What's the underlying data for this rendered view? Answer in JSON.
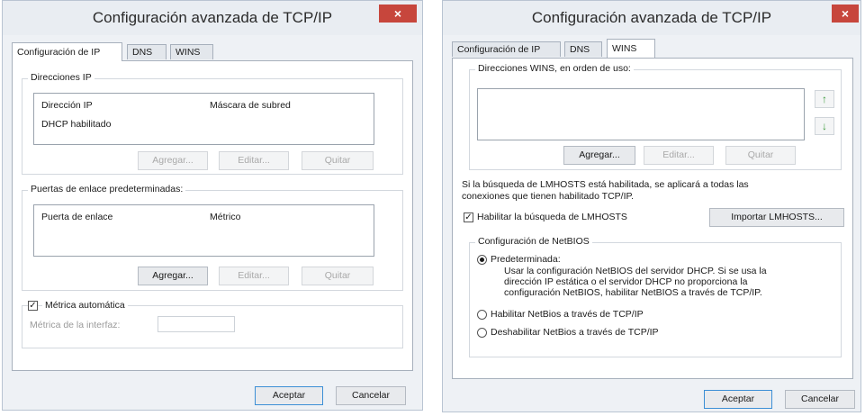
{
  "dialog1": {
    "title": "Configuración avanzada de TCP/IP",
    "close_label": "×",
    "tabs": [
      "Configuración de IP",
      "DNS",
      "WINS"
    ],
    "ip_group": {
      "label": "Direcciones IP",
      "columns": [
        "Dirección IP",
        "Máscara de subred"
      ],
      "rows": [
        "DHCP habilitado"
      ],
      "buttons": [
        "Agregar...",
        "Editar...",
        "Quitar"
      ]
    },
    "gateway_group": {
      "label": "Puertas de enlace predeterminadas:",
      "columns": [
        "Puerta de enlace",
        "Métrico"
      ],
      "buttons": [
        "Agregar...",
        "Editar...",
        "Quitar"
      ]
    },
    "auto_metric": {
      "label": "Métrica automática",
      "checked": true
    },
    "interface_metric_label": "Métrica de la interfaz:",
    "interface_metric_value": "",
    "ok_label": "Aceptar",
    "cancel_label": "Cancelar"
  },
  "dialog2": {
    "title": "Configuración avanzada de TCP/IP",
    "close_label": "×",
    "tabs": [
      "Configuración de IP",
      "DNS",
      "WINS"
    ],
    "wins_group": {
      "label": "Direcciones WINS, en orden de uso:",
      "up_label": "↑",
      "down_label": "↓",
      "buttons": [
        "Agregar...",
        "Editar...",
        "Quitar"
      ]
    },
    "lmhosts_info_line1": "Si la búsqueda de LMHOSTS está habilitada, se aplicará a todas las",
    "lmhosts_info_line2": "conexiones que tienen habilitado TCP/IP.",
    "lmhosts_checkbox": {
      "label": "Habilitar la búsqueda de LMHOSTS",
      "checked": true
    },
    "import_label": "Importar LMHOSTS...",
    "netbios_group": {
      "label": "Configuración de NetBIOS",
      "options": [
        "Predeterminada:",
        "Habilitar NetBios a través de TCP/IP",
        "Deshabilitar NetBios a través de TCP/IP"
      ],
      "selected": "Predeterminada:",
      "description": [
        "Usar la configuración NetBIOS del servidor DHCP. Si se usa la",
        "dirección IP estática o el servidor DHCP no proporciona la",
        "configuración NetBIOS, habilitar NetBIOS a través de TCP/IP."
      ]
    },
    "ok_label": "Aceptar",
    "cancel_label": "Cancelar"
  }
}
